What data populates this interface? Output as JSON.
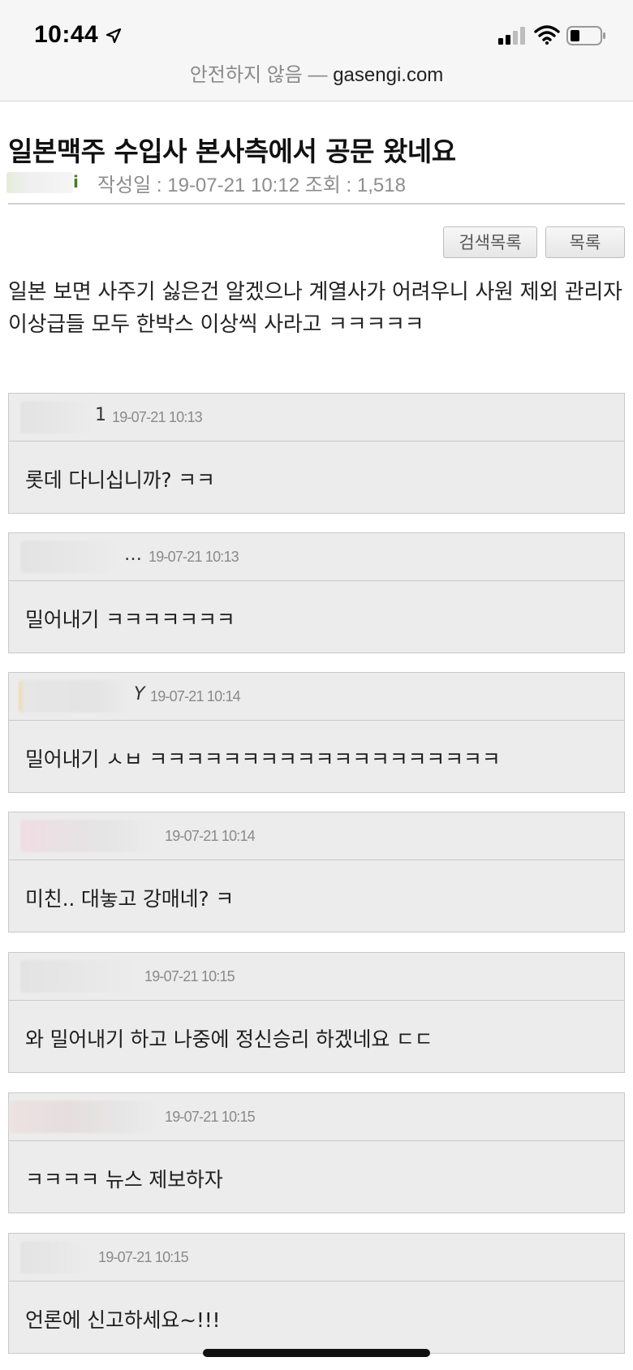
{
  "status_bar": {
    "time": "10:44",
    "icons": [
      "location-arrow-icon",
      "cellular-signal-icon",
      "wifi-icon",
      "battery-icon"
    ]
  },
  "url_bar": {
    "warning": "안전하지 않음 —",
    "host": "gasengi.com"
  },
  "post": {
    "title": "일본맥주 수입사 본사측에서 공문 왔네요",
    "author_tail": "i",
    "meta": "작성일 : 19-07-21 10:12  조회 : 1,518",
    "buttons": {
      "search_list": "검색목록",
      "list": "목록"
    },
    "body": "일본 보면 사주기 싫은건 알겠으나 계열사가 어려우니 사원 제외 관리자 이상급들 모두 한박스 이상씩 사라고 ㅋㅋㅋㅋㅋ"
  },
  "comments": [
    {
      "author_tail": "1",
      "date": "19-07-21 10:13",
      "text": "롯데 다니십니까? ㅋㅋ"
    },
    {
      "author_tail": "…",
      "date": "19-07-21 10:13",
      "text": "밀어내기 ㅋㅋㅋㅋㅋㅋㅋ"
    },
    {
      "author_tail": "Y",
      "date": "19-07-21 10:14",
      "text": "밀어내기 ㅅㅂ ㅋㅋㅋㅋㅋㅋㅋㅋㅋㅋㅋㅋㅋㅋㅋㅋㅋㅋㅋ"
    },
    {
      "author_tail": "",
      "date": "19-07-21 10:14",
      "text": "미친.. 대놓고 강매네? ㅋ"
    },
    {
      "author_tail": "",
      "date": "19-07-21 10:15",
      "text": "와 밀어내기 하고 나중에 정신승리 하겠네요 ㄷㄷ"
    },
    {
      "author_tail": "",
      "date": "19-07-21 10:15",
      "text": "ㅋㅋㅋㅋ 뉴스 제보하자"
    },
    {
      "author_tail": "",
      "date": "19-07-21 10:15",
      "text": "언론에 신고하세요~!!!"
    }
  ]
}
